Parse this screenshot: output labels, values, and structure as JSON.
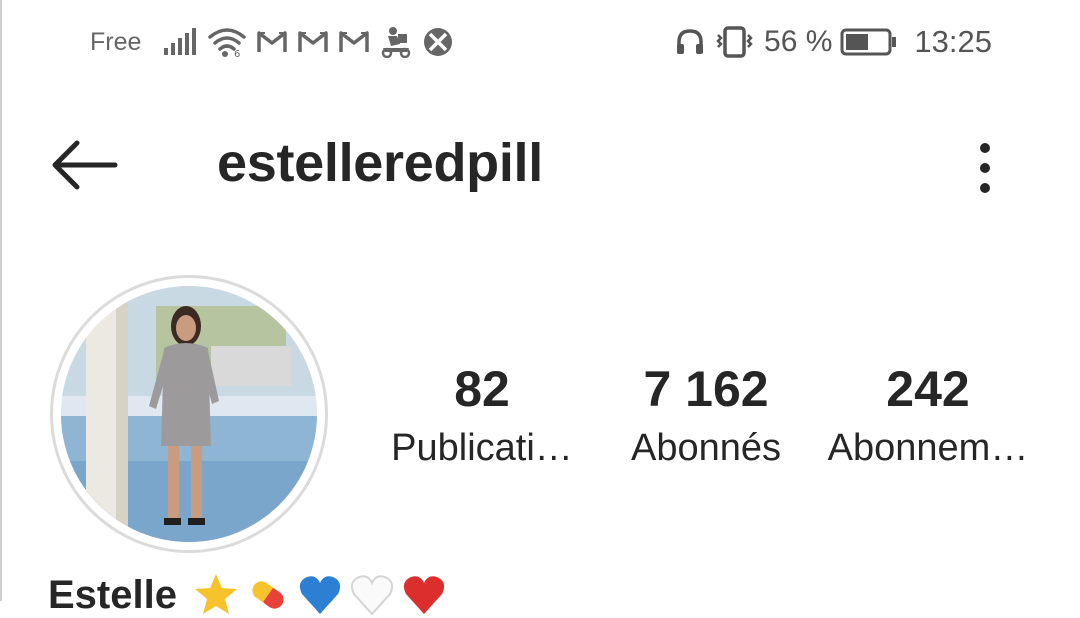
{
  "status_bar": {
    "carrier": "Free",
    "battery_percent": "56 %",
    "battery_level": 0.56,
    "time": "13:25",
    "icons": [
      "signal-icon",
      "wifi-icon",
      "gmail-icon",
      "gmail-icon",
      "gmail-icon",
      "delivery-scooter-icon",
      "xbox-icon",
      "headphones-icon",
      "vibrate-icon",
      "battery-icon"
    ]
  },
  "header": {
    "username": "estelleredpill"
  },
  "profile": {
    "stats": [
      {
        "value": "82",
        "label": "Publicati…"
      },
      {
        "value": "7 162",
        "label": "Abonnés"
      },
      {
        "value": "242",
        "label": "Abonnem…"
      }
    ],
    "bio_name": "Estelle",
    "bio_emojis": [
      "star-emoji",
      "pill-emoji",
      "blue-heart-emoji",
      "white-heart-emoji",
      "red-heart-emoji"
    ]
  },
  "colors": {
    "text": "#262626",
    "status_text": "#555555",
    "avatar_ring": "#dbdbdb"
  }
}
